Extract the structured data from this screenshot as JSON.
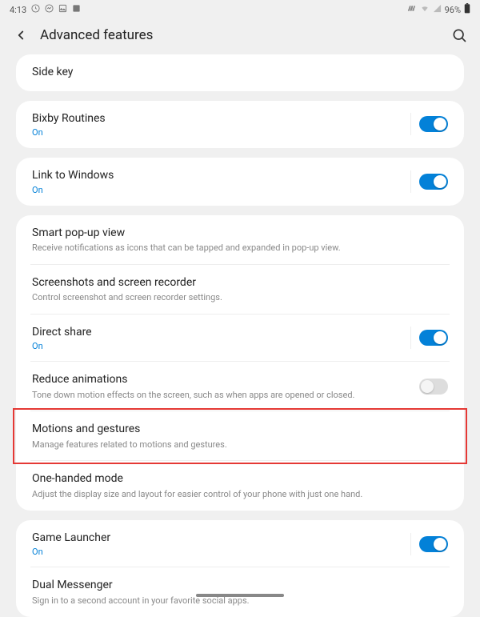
{
  "status_bar": {
    "time": "4:13",
    "battery": "96%"
  },
  "header": {
    "title": "Advanced features"
  },
  "groups": [
    {
      "items": [
        {
          "title": "Side key"
        }
      ]
    },
    {
      "items": [
        {
          "title": "Bixby Routines",
          "status": "On",
          "toggle": "on",
          "toggle_divider": true
        }
      ]
    },
    {
      "items": [
        {
          "title": "Link to Windows",
          "status": "On",
          "toggle": "on",
          "toggle_divider": true
        }
      ]
    },
    {
      "items": [
        {
          "title": "Smart pop-up view",
          "sub": "Receive notifications as icons that can be tapped and expanded in pop-up view.",
          "divider": true
        },
        {
          "title": "Screenshots and screen recorder",
          "sub": "Control screenshot and screen recorder settings.",
          "divider": true
        },
        {
          "title": "Direct share",
          "status": "On",
          "toggle": "on",
          "toggle_divider": true,
          "divider": true
        },
        {
          "title": "Reduce animations",
          "sub": "Tone down motion effects on the screen, such as when apps are opened or closed.",
          "toggle": "off",
          "divider": true
        },
        {
          "title": "Motions and gestures",
          "sub": "Manage features related to motions and gestures.",
          "divider": true,
          "highlight": true
        },
        {
          "title": "One-handed mode",
          "sub": "Adjust the display size and layout for easier control of your phone with just one hand."
        }
      ]
    },
    {
      "items": [
        {
          "title": "Game Launcher",
          "status": "On",
          "toggle": "on",
          "toggle_divider": true,
          "divider": true
        },
        {
          "title": "Dual Messenger",
          "sub": "Sign in to a second account in your favorite social apps."
        }
      ]
    }
  ]
}
